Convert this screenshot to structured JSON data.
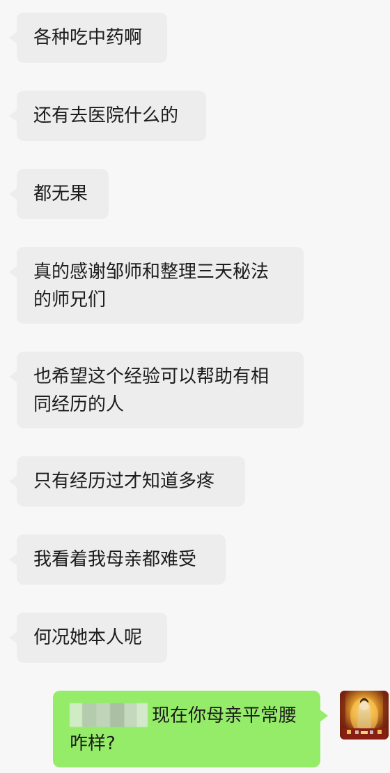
{
  "messages": [
    {
      "side": "left",
      "text": "各种吃中药啊"
    },
    {
      "side": "left",
      "text": "还有去医院什么的"
    },
    {
      "side": "left",
      "text": "都无果"
    },
    {
      "side": "left",
      "lines": [
        "真的感谢邹师和整理三天秘法",
        "的师兄们"
      ]
    },
    {
      "side": "left",
      "lines": [
        "也希望这个经验可以帮助有相",
        "同经历的人"
      ]
    },
    {
      "side": "left",
      "text": "只有经历过才知道多疼"
    },
    {
      "side": "left",
      "text": "我看着我母亲都难受"
    },
    {
      "side": "left",
      "text": "何况她本人呢"
    },
    {
      "side": "right",
      "text": "现在你母亲平常腰咋样?"
    }
  ],
  "colors": {
    "background": "#f7f7f7",
    "left_bubble": "#ededed",
    "right_bubble": "#95ec69",
    "text": "#1c1c1c"
  },
  "icons": {
    "avatar": "buddhist-statue-avatar",
    "mention": "blurred-username"
  }
}
